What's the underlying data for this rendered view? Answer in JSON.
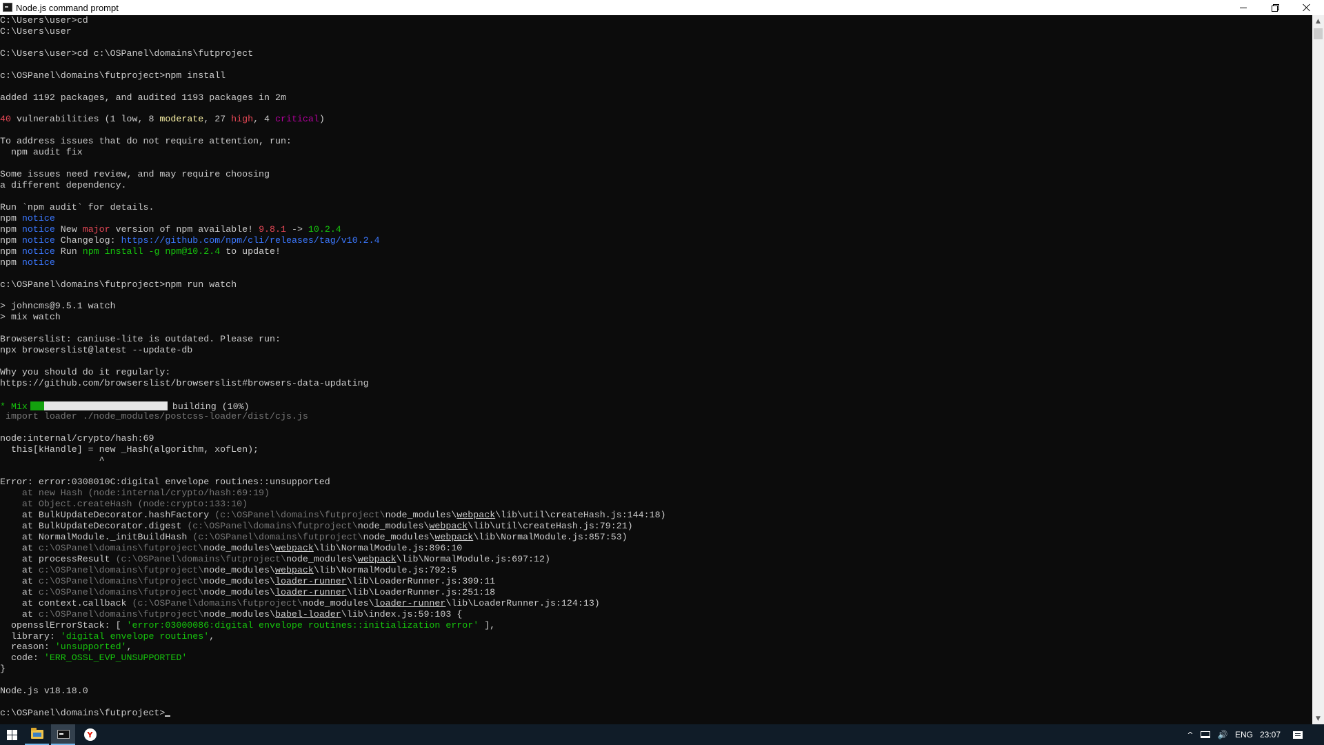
{
  "window": {
    "title": "Node.js command prompt"
  },
  "console": {
    "lines": [
      [
        {
          "t": "C:\\Users\\user>cd"
        }
      ],
      [
        {
          "t": "C:\\Users\\user"
        }
      ],
      [],
      [
        {
          "t": "C:\\Users\\user>cd c:\\OSPanel\\domains\\futproject"
        }
      ],
      [],
      [
        {
          "t": "c:\\OSPanel\\domains\\futproject>npm install"
        }
      ],
      [],
      [
        {
          "t": "added 1192 packages, and audited 1193 packages in 2m"
        }
      ],
      [],
      [
        {
          "t": "40",
          "c": "r"
        },
        {
          "t": " vulnerabilities (1 low, 8 "
        },
        {
          "t": "moderate",
          "c": "y"
        },
        {
          "t": ", 27 "
        },
        {
          "t": "high",
          "c": "r"
        },
        {
          "t": ", 4 "
        },
        {
          "t": "critical",
          "c": "m"
        },
        {
          "t": ")"
        }
      ],
      [],
      [
        {
          "t": "To address issues that do not require attention, run:"
        }
      ],
      [
        {
          "t": "  npm audit fix"
        }
      ],
      [],
      [
        {
          "t": "Some issues need review, and may require choosing"
        }
      ],
      [
        {
          "t": "a different dependency."
        }
      ],
      [],
      [
        {
          "t": "Run `npm audit` for details."
        }
      ],
      [
        {
          "t": "npm "
        },
        {
          "t": "notice",
          "c": "b"
        }
      ],
      [
        {
          "t": "npm "
        },
        {
          "t": "notice",
          "c": "b"
        },
        {
          "t": " New "
        },
        {
          "t": "major",
          "c": "r"
        },
        {
          "t": " version of npm available! "
        },
        {
          "t": "9.8.1",
          "c": "r"
        },
        {
          "t": " -> "
        },
        {
          "t": "10.2.4",
          "c": "g"
        }
      ],
      [
        {
          "t": "npm "
        },
        {
          "t": "notice",
          "c": "b"
        },
        {
          "t": " Changelog: "
        },
        {
          "t": "https://github.com/npm/cli/releases/tag/v10.2.4",
          "c": "b"
        }
      ],
      [
        {
          "t": "npm "
        },
        {
          "t": "notice",
          "c": "b"
        },
        {
          "t": " Run "
        },
        {
          "t": "npm install -g npm@10.2.4",
          "c": "g"
        },
        {
          "t": " to update!"
        }
      ],
      [
        {
          "t": "npm "
        },
        {
          "t": "notice",
          "c": "b"
        }
      ],
      [],
      [
        {
          "t": "c:\\OSPanel\\domains\\futproject>npm run watch"
        }
      ],
      [],
      [
        {
          "t": "> johncms@9.5.1 watch"
        }
      ],
      [
        {
          "t": "> mix watch"
        }
      ],
      [],
      [
        {
          "t": "Browserslist: caniuse-lite is outdated. Please run:"
        }
      ],
      [
        {
          "t": "npx browserslist@latest --update-db"
        }
      ],
      [],
      [
        {
          "t": "Why you should do it regularly:"
        }
      ],
      [
        {
          "t": "https://github.com/browserslist/browserslist#browsers-data-updating"
        }
      ],
      [],
      [
        {
          "t": "* Mix",
          "c": "g"
        },
        {
          "progress": true
        },
        {
          "t": "building (10%)"
        }
      ],
      [
        {
          "t": " import loader ./node_modules/postcss-loader/dist/cjs.js",
          "c": "gr"
        }
      ],
      [],
      [
        {
          "t": "node:internal/crypto/hash:69"
        }
      ],
      [
        {
          "t": "  this[kHandle] = new _Hash(algorithm, xofLen);"
        }
      ],
      [
        {
          "t": "                  ^"
        }
      ],
      [],
      [
        {
          "t": "Error: error:0308010C:digital envelope routines::unsupported"
        }
      ],
      [
        {
          "t": "    at new Hash (node:internal/crypto/hash:69:19)",
          "c": "gr"
        }
      ],
      [
        {
          "t": "    at Object.createHash (node:crypto:133:10)",
          "c": "gr"
        }
      ],
      [
        {
          "t": "    at BulkUpdateDecorator.hashFactory "
        },
        {
          "t": "(c:\\OSPanel\\domains\\futproject\\",
          "c": "gr"
        },
        {
          "t": "node_modules\\"
        },
        {
          "t": "webpack",
          "u": 1
        },
        {
          "t": "\\lib\\util\\createHash.js:144:18)"
        }
      ],
      [
        {
          "t": "    at BulkUpdateDecorator.digest "
        },
        {
          "t": "(c:\\OSPanel\\domains\\futproject\\",
          "c": "gr"
        },
        {
          "t": "node_modules\\"
        },
        {
          "t": "webpack",
          "u": 1
        },
        {
          "t": "\\lib\\util\\createHash.js:79:21)"
        }
      ],
      [
        {
          "t": "    at NormalModule._initBuildHash "
        },
        {
          "t": "(c:\\OSPanel\\domains\\futproject\\",
          "c": "gr"
        },
        {
          "t": "node_modules\\"
        },
        {
          "t": "webpack",
          "u": 1
        },
        {
          "t": "\\lib\\NormalModule.js:857:53)"
        }
      ],
      [
        {
          "t": "    at "
        },
        {
          "t": "c:\\OSPanel\\domains\\futproject\\",
          "c": "gr"
        },
        {
          "t": "node_modules\\"
        },
        {
          "t": "webpack",
          "u": 1
        },
        {
          "t": "\\lib\\NormalModule.js:896:10"
        }
      ],
      [
        {
          "t": "    at processResult "
        },
        {
          "t": "(c:\\OSPanel\\domains\\futproject\\",
          "c": "gr"
        },
        {
          "t": "node_modules\\"
        },
        {
          "t": "webpack",
          "u": 1
        },
        {
          "t": "\\lib\\NormalModule.js:697:12)"
        }
      ],
      [
        {
          "t": "    at "
        },
        {
          "t": "c:\\OSPanel\\domains\\futproject\\",
          "c": "gr"
        },
        {
          "t": "node_modules\\"
        },
        {
          "t": "webpack",
          "u": 1
        },
        {
          "t": "\\lib\\NormalModule.js:792:5"
        }
      ],
      [
        {
          "t": "    at "
        },
        {
          "t": "c:\\OSPanel\\domains\\futproject\\",
          "c": "gr"
        },
        {
          "t": "node_modules\\"
        },
        {
          "t": "loader-runner",
          "u": 1
        },
        {
          "t": "\\lib\\LoaderRunner.js:399:11"
        }
      ],
      [
        {
          "t": "    at "
        },
        {
          "t": "c:\\OSPanel\\domains\\futproject\\",
          "c": "gr"
        },
        {
          "t": "node_modules\\"
        },
        {
          "t": "loader-runner",
          "u": 1
        },
        {
          "t": "\\lib\\LoaderRunner.js:251:18"
        }
      ],
      [
        {
          "t": "    at context.callback "
        },
        {
          "t": "(c:\\OSPanel\\domains\\futproject\\",
          "c": "gr"
        },
        {
          "t": "node_modules\\"
        },
        {
          "t": "loader-runner",
          "u": 1
        },
        {
          "t": "\\lib\\LoaderRunner.js:124:13)"
        }
      ],
      [
        {
          "t": "    at "
        },
        {
          "t": "c:\\OSPanel\\domains\\futproject\\",
          "c": "gr"
        },
        {
          "t": "node_modules\\"
        },
        {
          "t": "babel-loader",
          "u": 1
        },
        {
          "t": "\\lib\\index.js:59:103 {"
        }
      ],
      [
        {
          "t": "  opensslErrorStack: [ "
        },
        {
          "t": "'error:03000086:digital envelope routines::initialization error'",
          "c": "g"
        },
        {
          "t": " ],"
        }
      ],
      [
        {
          "t": "  library: "
        },
        {
          "t": "'digital envelope routines'",
          "c": "g"
        },
        {
          "t": ","
        }
      ],
      [
        {
          "t": "  reason: "
        },
        {
          "t": "'unsupported'",
          "c": "g"
        },
        {
          "t": ","
        }
      ],
      [
        {
          "t": "  code: "
        },
        {
          "t": "'ERR_OSSL_EVP_UNSUPPORTED'",
          "c": "g"
        }
      ],
      [
        {
          "t": "}"
        }
      ],
      [],
      [
        {
          "t": "Node.js v18.18.0"
        }
      ],
      [],
      [
        {
          "t": "c:\\OSPanel\\domains\\futproject>"
        },
        {
          "cursor": true
        }
      ]
    ],
    "progress": {
      "value": 0.1
    }
  },
  "icons": {
    "window": "console-app-icon",
    "minimize": "minimize-icon",
    "restore": "restore-icon",
    "close": "close-icon",
    "start": "windows-logo-icon",
    "explorer": "folder-icon",
    "cmd": "command-prompt-icon",
    "browser": "yandex-browser-icon",
    "tray_more": "chevron-up-icon",
    "network": "network-icon",
    "volume": "speaker-icon",
    "notifications": "action-center-icon"
  },
  "tray": {
    "chevron": "^",
    "volume": "🔊",
    "language": "ENG",
    "time": "23:07"
  },
  "taskbar": {
    "browser_letter": "Y"
  },
  "scrollbar": {
    "up": "▲",
    "down": "▼"
  },
  "colors": {
    "console_bg": "#0c0c0c",
    "console_fg": "#cccccc",
    "red": "#e74856",
    "yellow": "#f9f1a5",
    "magenta": "#b4009e",
    "blue": "#3b78ff",
    "green": "#16c60c",
    "gray": "#767676",
    "taskbar_bg": "#101c28"
  }
}
